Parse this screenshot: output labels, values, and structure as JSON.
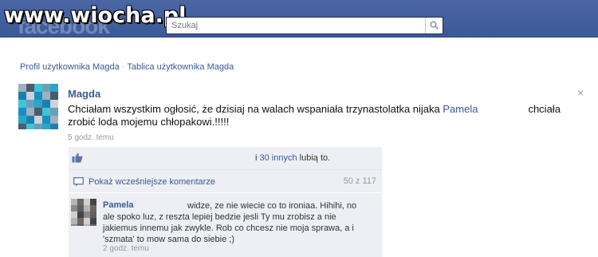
{
  "header": {
    "watermark": "www.wiocha.pl",
    "logo": "facebook",
    "search_placeholder": "Szukaj",
    "search_icon": "search-icon"
  },
  "breadcrumb": {
    "profile": "Profil użytkownika Magda",
    "separator": "·",
    "wall": "Tablica użytkownika Magda"
  },
  "post": {
    "author": "Magda",
    "text_before": "Chciałam wszystkim ogłosić, że dzisiaj na walach wspaniała trzynastolatka nijaka ",
    "mention": "Pamela",
    "text_after": "chciała zrobić loda mojemu chłopakowi.!!!!!",
    "time": "5 godz. temu",
    "close": "×"
  },
  "likes": {
    "prefix": "i ",
    "others_link": "30 innych",
    "suffix": " lubią to."
  },
  "comments": {
    "show_previous": "Pokaż wcześniejsze komentarze",
    "count": "50 z 117",
    "items": [
      {
        "author": "Pamela",
        "text": "widze, ze nie wiecie co to ironiaa. Hihihi, no ale spoko luz, z reszta lepiej bedzie jesli Ty mu zrobisz a nie jakiemus innemu jak zwykle. Rob co chcesz nie moja sprawa, a i 'szmata' to mow sama do siebie ;)",
        "time": "2 godz. temu"
      }
    ]
  },
  "colors": {
    "brand": "#3b5998",
    "panel": "#edeff4"
  }
}
